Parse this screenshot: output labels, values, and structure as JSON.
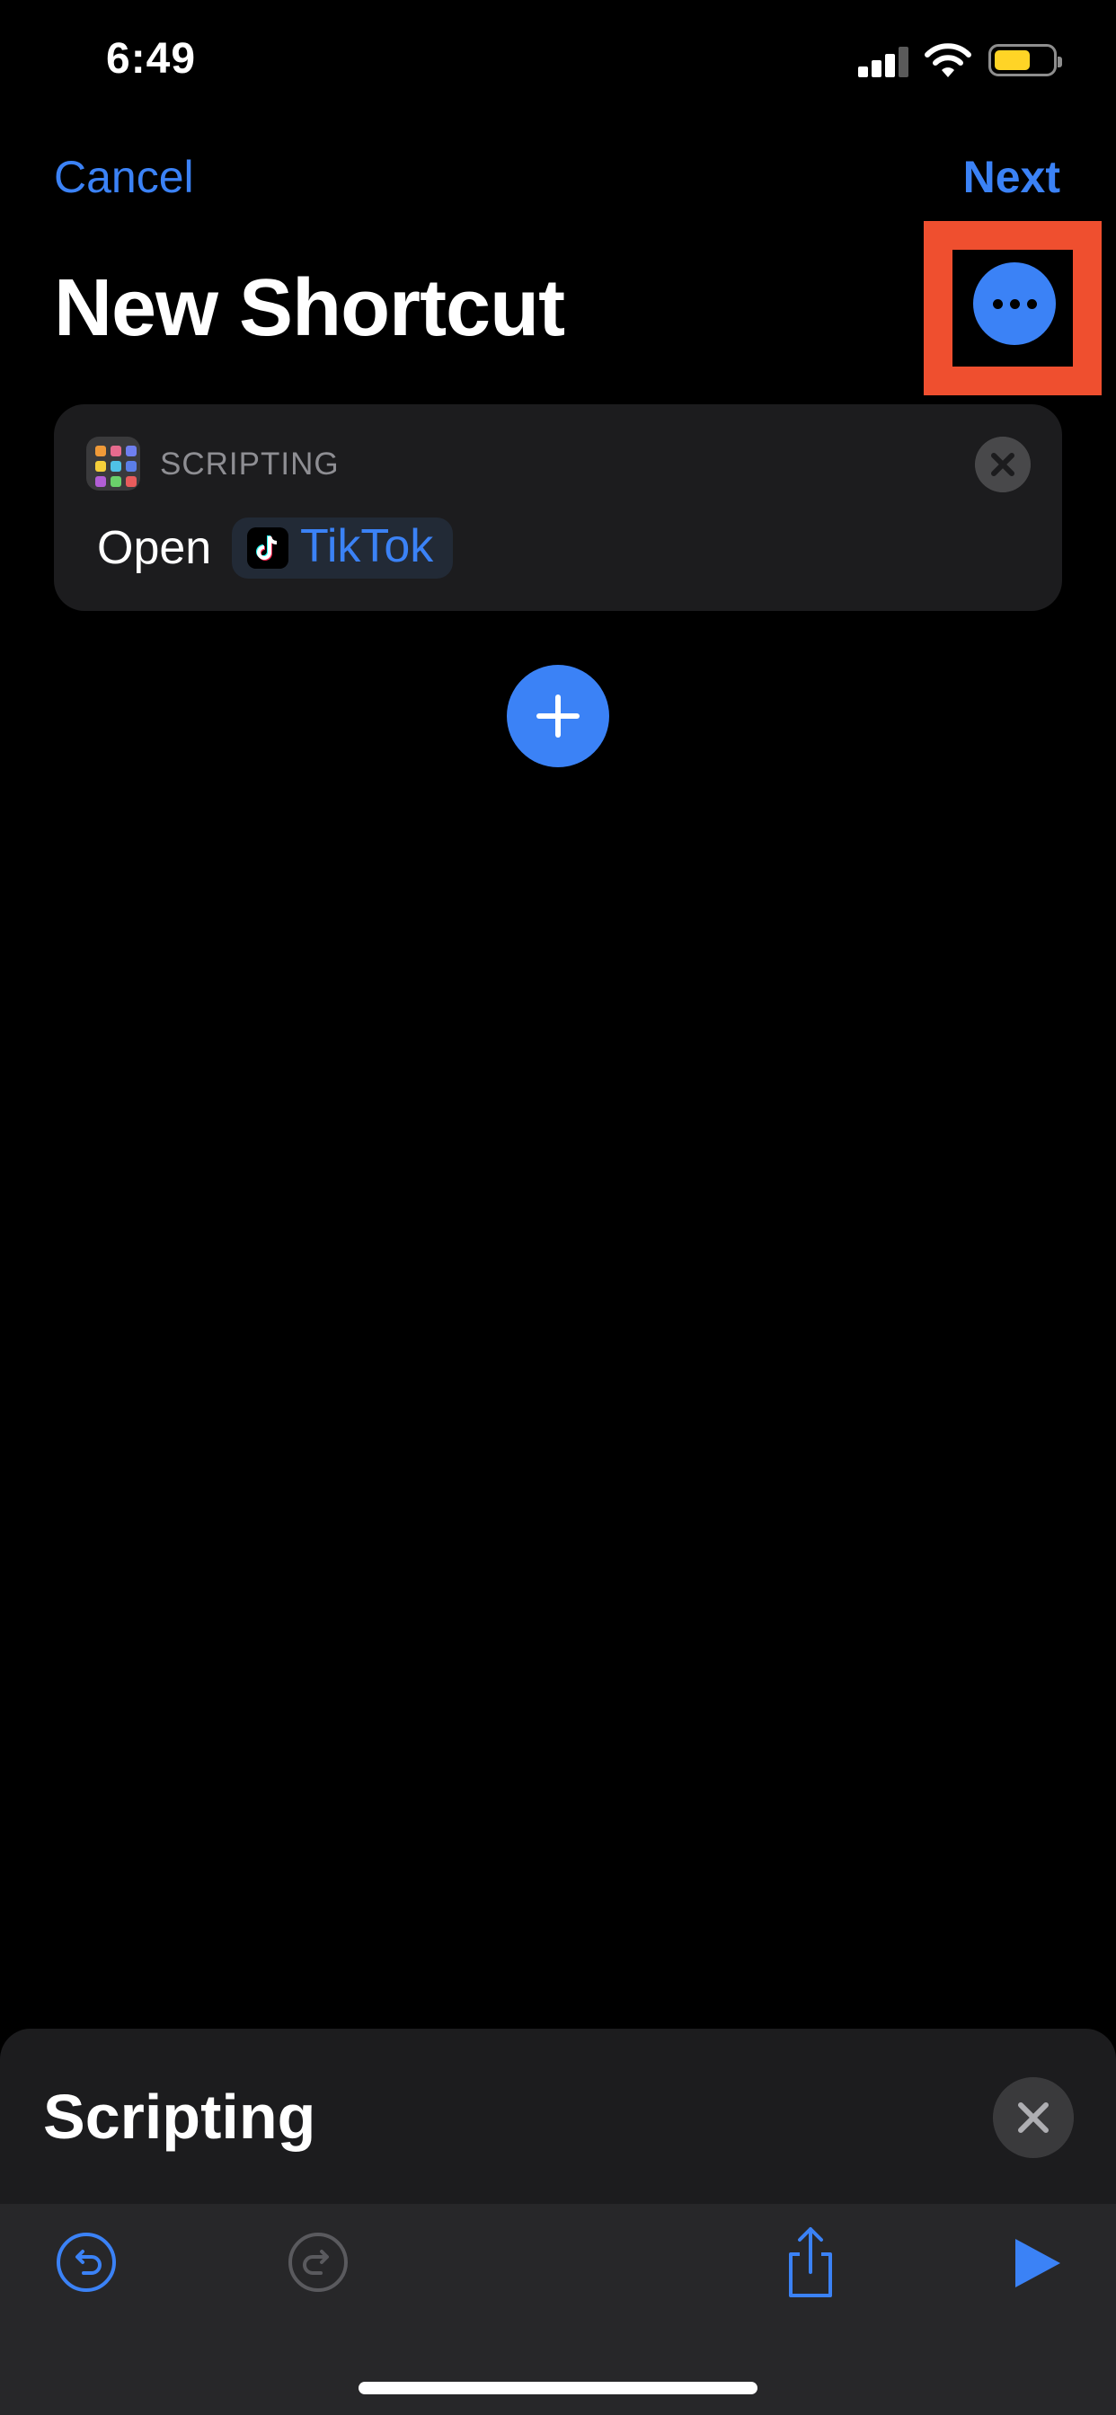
{
  "status_bar": {
    "time": "6:49"
  },
  "nav": {
    "cancel_label": "Cancel",
    "next_label": "Next"
  },
  "page": {
    "title": "New Shortcut"
  },
  "action_card": {
    "category": "SCRIPTING",
    "verb": "Open",
    "app_name": "TikTok"
  },
  "panel": {
    "title": "Scripting"
  },
  "colors": {
    "accent": "#3b82f6",
    "highlight": "#ef4f2f",
    "background": "#000000",
    "card": "#1c1c1e"
  },
  "icons": {
    "more": "ellipsis-icon",
    "add": "plus-icon",
    "close": "close-icon",
    "undo": "undo-icon",
    "redo": "redo-icon",
    "share": "share-icon",
    "play": "play-icon"
  }
}
